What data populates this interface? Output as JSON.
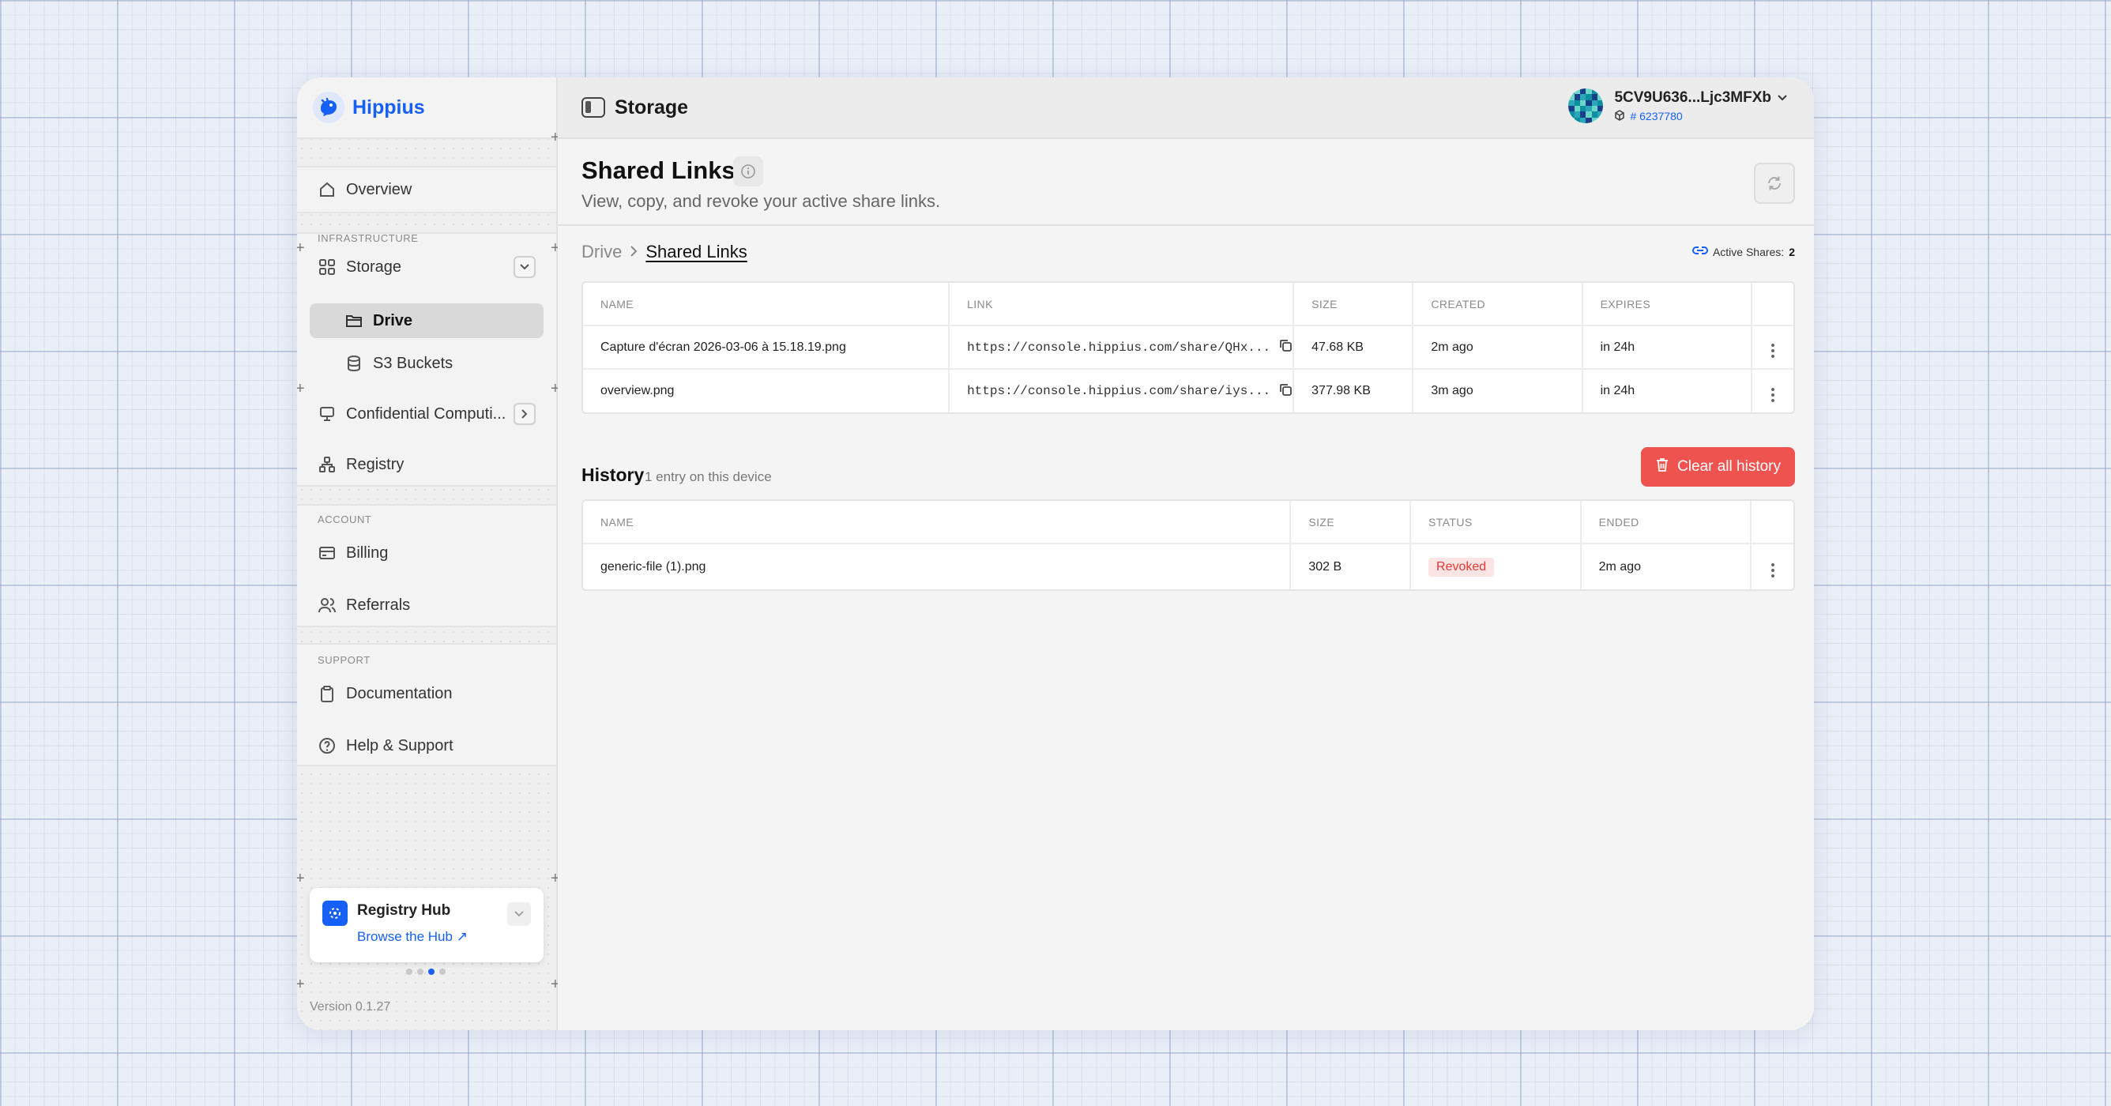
{
  "brand": {
    "name": "Hippius"
  },
  "sidebar": {
    "overview": "Overview",
    "sections": {
      "infrastructure": "INFRASTRUCTURE",
      "account": "ACCOUNT",
      "support": "SUPPORT"
    },
    "storage": "Storage",
    "drive": "Drive",
    "s3": "S3 Buckets",
    "confidential": "Confidential Computi...",
    "registry": "Registry",
    "billing": "Billing",
    "referrals": "Referrals",
    "documentation": "Documentation",
    "help": "Help & Support",
    "hub": {
      "title": "Registry Hub",
      "link": "Browse the Hub"
    },
    "version": "Version 0.1.27"
  },
  "topbar": {
    "title": "Storage"
  },
  "account": {
    "name": "5CV9U636...Ljc3MFXb",
    "id": "# 6237780"
  },
  "page": {
    "title": "Shared Links",
    "subtitle": "View, copy, and revoke your active share links."
  },
  "breadcrumb": {
    "root": "Drive",
    "current": "Shared Links"
  },
  "active_shares": {
    "label": "Active Shares:",
    "count": "2"
  },
  "shares_table": {
    "headers": {
      "name": "NAME",
      "link": "LINK",
      "size": "SIZE",
      "created": "CREATED",
      "expires": "EXPIRES"
    },
    "rows": [
      {
        "name": "Capture d'écran 2026-03-06 à 15.18.19.png",
        "link": "https://console.hippius.com/share/QHx...",
        "size": "47.68 KB",
        "created": "2m ago",
        "expires": "in 24h"
      },
      {
        "name": "overview.png",
        "link": "https://console.hippius.com/share/iys...",
        "size": "377.98 KB",
        "created": "3m ago",
        "expires": "in 24h"
      }
    ]
  },
  "history": {
    "title": "History",
    "count": "1 entry on this device",
    "clear_label": "Clear all history",
    "headers": {
      "name": "NAME",
      "size": "SIZE",
      "status": "STATUS",
      "ended": "ENDED"
    },
    "rows": [
      {
        "name": "generic-file (1).png",
        "size": "302 B",
        "status": "Revoked",
        "ended": "2m ago"
      }
    ]
  },
  "colors": {
    "accent": "#1660f5",
    "danger": "#ef5350",
    "revoked_bg": "#fde4e4"
  }
}
